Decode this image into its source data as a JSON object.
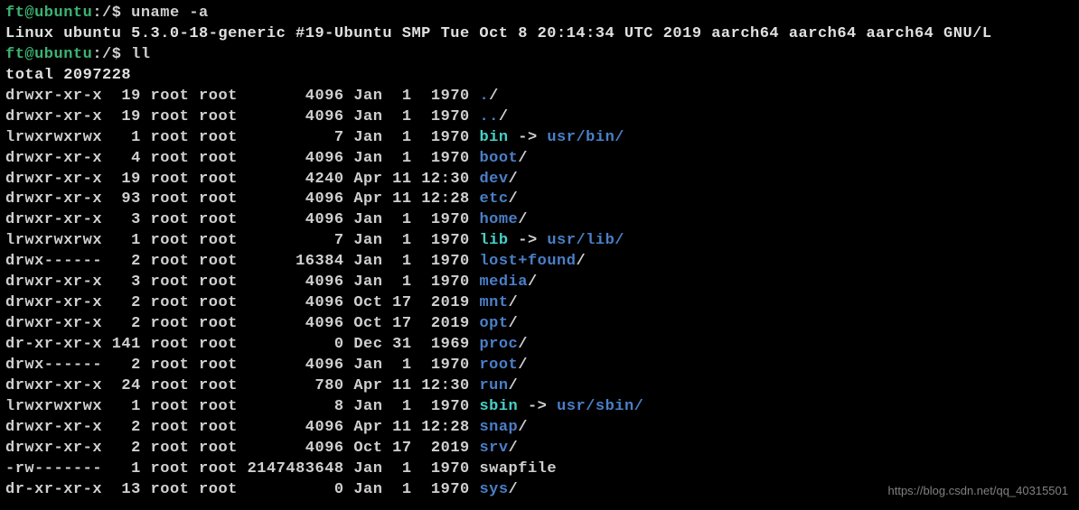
{
  "prompt1": {
    "user": "ft",
    "host": "ubuntu",
    "path": "/",
    "symbol": "$",
    "command": "uname -a"
  },
  "uname_output": "Linux ubuntu 5.3.0-18-generic #19-Ubuntu SMP Tue Oct 8 20:14:34 UTC 2019 aarch64 aarch64 aarch64 GNU/L",
  "prompt2": {
    "user": "ft",
    "host": "ubuntu",
    "path": "/",
    "symbol": "$",
    "command": "ll"
  },
  "total_line": "total 2097228",
  "entries": [
    {
      "perms": "drwxr-xr-x",
      "links": " 19",
      "user": "root",
      "group": "root",
      "size": "      4096",
      "date": "Jan  1  1970",
      "name": ".",
      "type": "dir"
    },
    {
      "perms": "drwxr-xr-x",
      "links": " 19",
      "user": "root",
      "group": "root",
      "size": "      4096",
      "date": "Jan  1  1970",
      "name": "..",
      "type": "dir"
    },
    {
      "perms": "lrwxrwxrwx",
      "links": "  1",
      "user": "root",
      "group": "root",
      "size": "         7",
      "date": "Jan  1  1970",
      "name": "bin",
      "type": "link",
      "target": "usr/bin/"
    },
    {
      "perms": "drwxr-xr-x",
      "links": "  4",
      "user": "root",
      "group": "root",
      "size": "      4096",
      "date": "Jan  1  1970",
      "name": "boot",
      "type": "dir"
    },
    {
      "perms": "drwxr-xr-x",
      "links": " 19",
      "user": "root",
      "group": "root",
      "size": "      4240",
      "date": "Apr 11 12:30",
      "name": "dev",
      "type": "dir"
    },
    {
      "perms": "drwxr-xr-x",
      "links": " 93",
      "user": "root",
      "group": "root",
      "size": "      4096",
      "date": "Apr 11 12:28",
      "name": "etc",
      "type": "dir"
    },
    {
      "perms": "drwxr-xr-x",
      "links": "  3",
      "user": "root",
      "group": "root",
      "size": "      4096",
      "date": "Jan  1  1970",
      "name": "home",
      "type": "dir"
    },
    {
      "perms": "lrwxrwxrwx",
      "links": "  1",
      "user": "root",
      "group": "root",
      "size": "         7",
      "date": "Jan  1  1970",
      "name": "lib",
      "type": "link",
      "target": "usr/lib/"
    },
    {
      "perms": "drwx------",
      "links": "  2",
      "user": "root",
      "group": "root",
      "size": "     16384",
      "date": "Jan  1  1970",
      "name": "lost+found",
      "type": "dir"
    },
    {
      "perms": "drwxr-xr-x",
      "links": "  3",
      "user": "root",
      "group": "root",
      "size": "      4096",
      "date": "Jan  1  1970",
      "name": "media",
      "type": "dir"
    },
    {
      "perms": "drwxr-xr-x",
      "links": "  2",
      "user": "root",
      "group": "root",
      "size": "      4096",
      "date": "Oct 17  2019",
      "name": "mnt",
      "type": "dir"
    },
    {
      "perms": "drwxr-xr-x",
      "links": "  2",
      "user": "root",
      "group": "root",
      "size": "      4096",
      "date": "Oct 17  2019",
      "name": "opt",
      "type": "dir"
    },
    {
      "perms": "dr-xr-xr-x",
      "links": "141",
      "user": "root",
      "group": "root",
      "size": "         0",
      "date": "Dec 31  1969",
      "name": "proc",
      "type": "dir"
    },
    {
      "perms": "drwx------",
      "links": "  2",
      "user": "root",
      "group": "root",
      "size": "      4096",
      "date": "Jan  1  1970",
      "name": "root",
      "type": "dir"
    },
    {
      "perms": "drwxr-xr-x",
      "links": " 24",
      "user": "root",
      "group": "root",
      "size": "       780",
      "date": "Apr 11 12:30",
      "name": "run",
      "type": "dir"
    },
    {
      "perms": "lrwxrwxrwx",
      "links": "  1",
      "user": "root",
      "group": "root",
      "size": "         8",
      "date": "Jan  1  1970",
      "name": "sbin",
      "type": "link",
      "target": "usr/sbin/"
    },
    {
      "perms": "drwxr-xr-x",
      "links": "  2",
      "user": "root",
      "group": "root",
      "size": "      4096",
      "date": "Apr 11 12:28",
      "name": "snap",
      "type": "dir"
    },
    {
      "perms": "drwxr-xr-x",
      "links": "  2",
      "user": "root",
      "group": "root",
      "size": "      4096",
      "date": "Oct 17  2019",
      "name": "srv",
      "type": "dir"
    },
    {
      "perms": "-rw-------",
      "links": "  1",
      "user": "root",
      "group": "root",
      "size": "2147483648",
      "date": "Jan  1  1970",
      "name": "swapfile",
      "type": "file"
    },
    {
      "perms": "dr-xr-xr-x",
      "links": " 13",
      "user": "root",
      "group": "root",
      "size": "         0",
      "date": "Jan  1  1970",
      "name": "sys",
      "type": "dir"
    }
  ],
  "watermark": "https://blog.csdn.net/qq_40315501"
}
